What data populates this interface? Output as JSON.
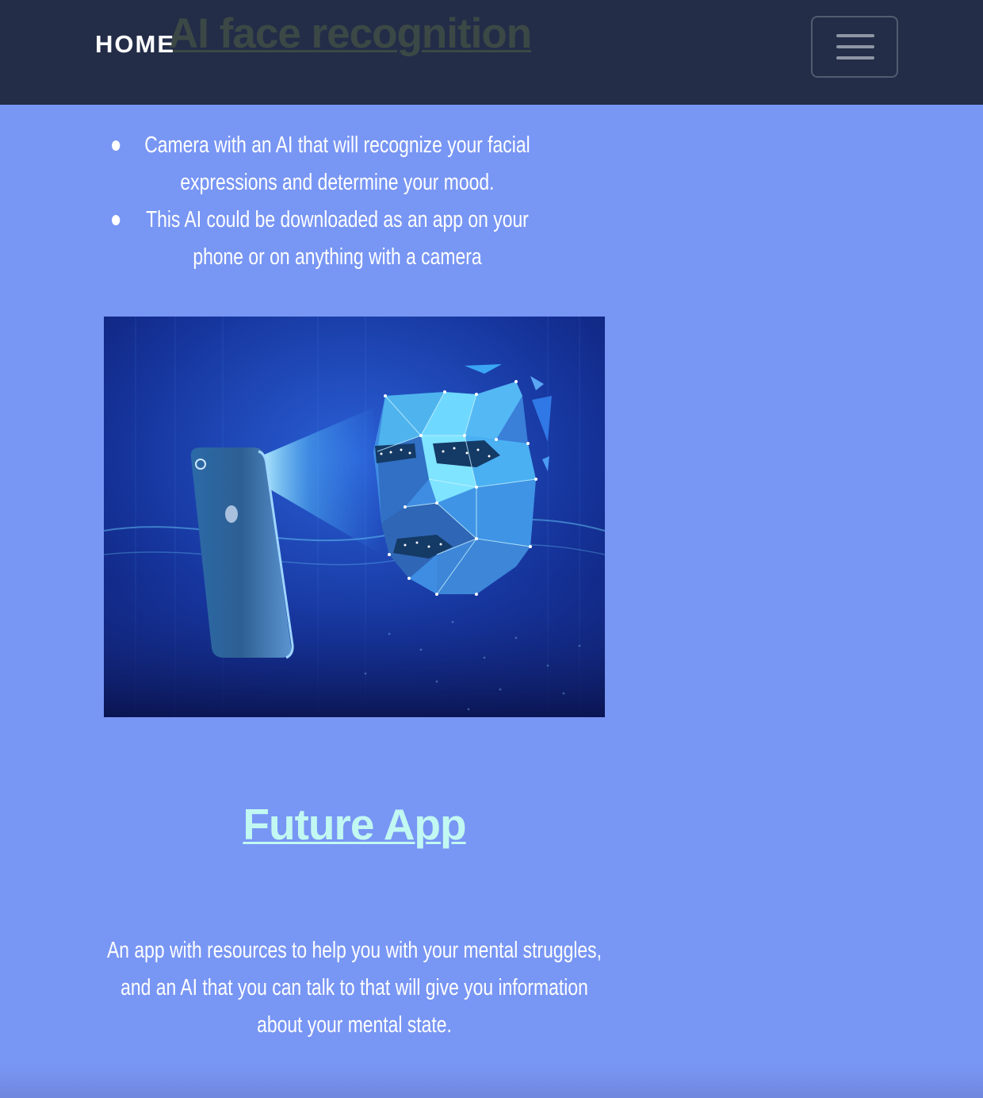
{
  "nav": {
    "brand_label": "HOME",
    "menu_icon": "hamburger-menu-icon"
  },
  "page": {
    "title": "AI face recognition"
  },
  "features": {
    "items": [
      "Camera with an AI that will recognize your facial expressions and determine your mood.",
      "This AI could be downloaded as an app on your phone or on anything with a camera"
    ]
  },
  "image": {
    "subject": "face-recognition-illustration",
    "icons": [
      "smartphone-icon",
      "polygon-face-mesh-icon"
    ]
  },
  "future_app": {
    "title": "Future App",
    "description": "An app with resources to help you with your mental struggles, and an AI that you can talk to that will give you information about your mental state."
  },
  "colors": {
    "nav_background": "#232d48",
    "page_background": "#7896f4",
    "page_title": "#3c4845",
    "section_title": "#c2f8f2",
    "body_text": "#ffffff"
  }
}
